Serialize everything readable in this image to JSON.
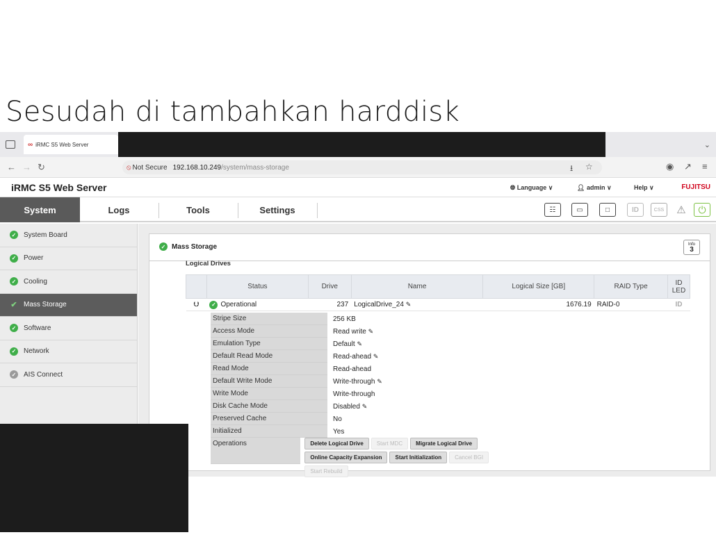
{
  "slide": {
    "title": "Sesudah di tambahkan harddisk"
  },
  "browser": {
    "tab_title": "iRMC S5 Web Server",
    "not_secure": "Not Secure",
    "url_host": "192.168.10.249",
    "url_path": "/system/mass-storage"
  },
  "header": {
    "brand": "iRMC S5 Web Server",
    "language": "Language",
    "user": "admin",
    "help": "Help",
    "vendor": "FUJITSU"
  },
  "nav": {
    "system": "System",
    "logs": "Logs",
    "tools": "Tools",
    "settings": "Settings",
    "id_label": "ID",
    "css_label": "CSS"
  },
  "sidebar": {
    "items": [
      {
        "label": "System Board"
      },
      {
        "label": "Power"
      },
      {
        "label": "Cooling"
      },
      {
        "label": "Mass Storage"
      },
      {
        "label": "Software"
      },
      {
        "label": "Network"
      },
      {
        "label": "AIS Connect"
      }
    ]
  },
  "panel": {
    "title": "Mass Storage",
    "info_label": "Info",
    "info_count": "3",
    "section": "Logical Drives"
  },
  "table": {
    "headers": [
      "Status",
      "Drive",
      "Name",
      "Logical Size [GB]",
      "RAID Type",
      "ID LED"
    ],
    "row": {
      "status": "Operational",
      "drive": "237",
      "name": "LogicalDrive_24",
      "size": "1676.19",
      "raid": "RAID-0",
      "id_led": "ID"
    }
  },
  "details": [
    {
      "key": "Stripe Size",
      "value": "256 KB"
    },
    {
      "key": "Access Mode",
      "value": "Read write"
    },
    {
      "key": "Emulation Type",
      "value": "Default"
    },
    {
      "key": "Default Read Mode",
      "value": "Read-ahead"
    },
    {
      "key": "Read Mode",
      "value": "Read-ahead"
    },
    {
      "key": "Default Write Mode",
      "value": "Write-through"
    },
    {
      "key": "Write Mode",
      "value": "Write-through"
    },
    {
      "key": "Disk Cache Mode",
      "value": "Disabled"
    },
    {
      "key": "Preserved Cache",
      "value": "No"
    },
    {
      "key": "Initialized",
      "value": "Yes"
    }
  ],
  "operations": {
    "label": "Operations",
    "buttons": [
      "Delete Logical Drive",
      "Start MDC",
      "Migrate Logical Drive",
      "Online Capacity Expansion",
      "Start Initialization",
      "Cancel BGI",
      "Start Rebuild"
    ]
  }
}
